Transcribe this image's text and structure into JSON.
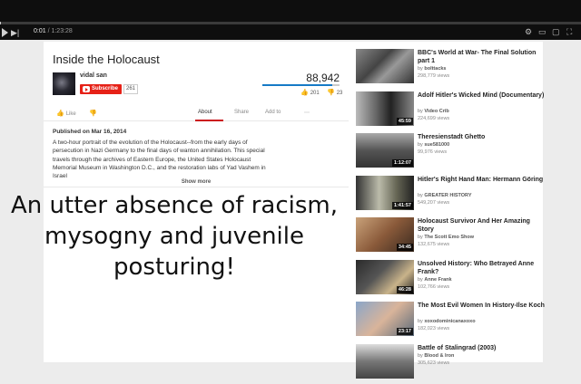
{
  "player": {
    "current_time": "0:01",
    "duration": "1:23:28",
    "progress_fraction": 0.0002
  },
  "video": {
    "title": "Inside the Holocaust",
    "channel": "vidal san",
    "subscribe_label": "Subscribe",
    "subscriber_count": "261",
    "view_count": "88,942",
    "like_fraction": 0.9,
    "likes": "201",
    "dislikes": "23",
    "published": "Published on Mar 16, 2014",
    "description": "A two-hour portrait of the evolution of the Holocaust--from the early days of persecution in Nazi Germany to the final days of wanton annihilation. This special travels through the archives of Eastern Europe, the United States Holocaust Memorial Museum in Washington D.C., and the restoration labs of Yad Vashem in Israel",
    "show_more": "Show more"
  },
  "tabs": {
    "like": "Like",
    "about": "About",
    "share": "Share",
    "add_to": "Add to"
  },
  "overlay_caption": "An utter absence of racism, mysogny and juvenile posturing!",
  "recommendations": [
    {
      "title": "BBC's World at War- The Final Solution part 1",
      "by": "bolttacks",
      "views": "298,779 views",
      "duration": ""
    },
    {
      "title": "Adolf Hitler's Wicked Mind (Documentary)",
      "by": "Video Crib",
      "views": "224,699 views",
      "duration": "45:59"
    },
    {
      "title": "Theresienstadt Ghetto",
      "by": "sue581000",
      "views": "99,976 views",
      "duration": "1:12:07"
    },
    {
      "title": "Hitler's Right Hand Man: Hermann Göring",
      "by": "GREATER HISTORY",
      "views": "549,207 views",
      "duration": "1:41:57"
    },
    {
      "title": "Holocaust Survivor And Her Amazing Story",
      "by": "The Scott Emo Show",
      "views": "132,675 views",
      "duration": "34:45"
    },
    {
      "title": "Unsolved History: Who Betrayed Anne Frank?",
      "by": "Anne Frank",
      "views": "102,766 views",
      "duration": "46:28"
    },
    {
      "title": "The Most Evil Women In History-Ilse Koch",
      "by": "xoxodominicanaxoxo",
      "views": "182,023 views",
      "duration": "23:17"
    },
    {
      "title": "Battle of Stalingrad (2003)",
      "by": "Blood & Iron",
      "views": "305,623 views",
      "duration": ""
    }
  ],
  "by_prefix": "by"
}
